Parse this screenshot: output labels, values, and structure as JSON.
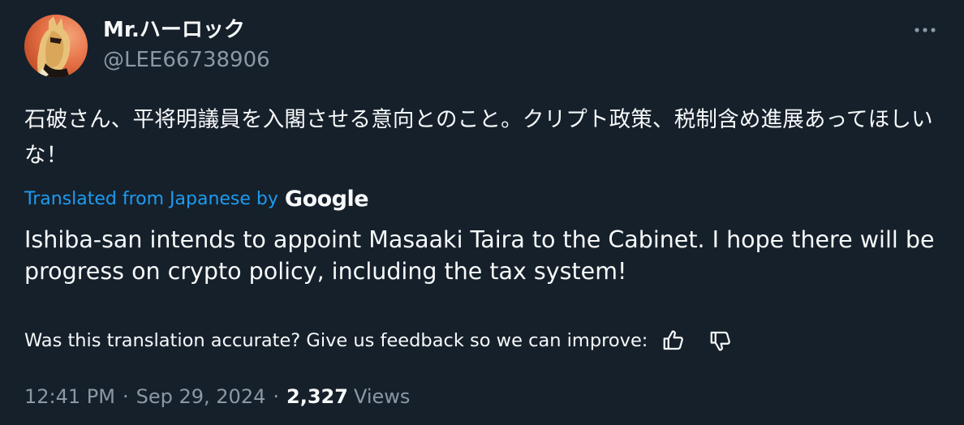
{
  "author": {
    "display_name": "Mr.ハーロック",
    "handle": "@LEE66738906"
  },
  "tweet": {
    "original_text": "石破さん、平将明議員を入閣させる意向とのこと。クリプト政策、税制含め進展あってほしいな！",
    "translated_label": "Translated from Japanese by",
    "translator_brand": "Google",
    "translated_text": "Ishiba-san intends to appoint Masaaki Taira to the Cabinet. I hope there will be progress on crypto policy, including the tax system!",
    "feedback_prompt": "Was this translation accurate? Give us feedback so we can improve:"
  },
  "meta": {
    "time": "12:41 PM",
    "separator": "·",
    "date": "Sep 29, 2024",
    "views_count": "2,327",
    "views_label": "Views"
  },
  "icons": {
    "more": "more-horizontal-icon",
    "thumb_up": "thumbs-up-icon",
    "thumb_down": "thumbs-down-icon"
  },
  "colors": {
    "background": "#15202b",
    "text": "#f7f9f9",
    "secondary_text": "#8b98a5",
    "link": "#1d9bf0"
  }
}
